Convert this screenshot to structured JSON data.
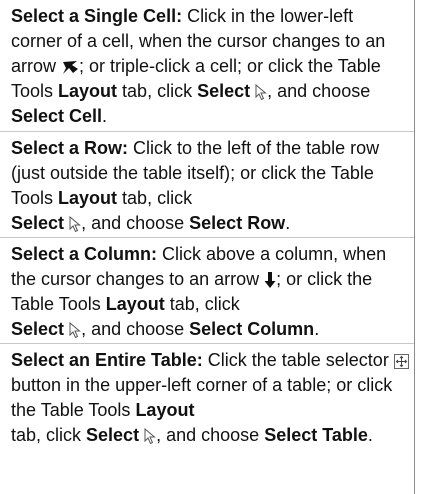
{
  "tips": [
    {
      "title": "Select a Single Cell:",
      "s1": " Click in the lower-left corner of a cell, when the cursor changes to an arrow ",
      "s2": "; or triple-click a cell; or click the Table Tools ",
      "b1": "Layout",
      "s3": " tab, click ",
      "b2": "Select",
      "s4": ", and choose ",
      "b3": "Select Cell",
      "s5": "."
    },
    {
      "title": "Select a Row:",
      "s1": " Click to the left of the table row (just outside the table itself); or click the Table Tools ",
      "b1": "Layout",
      "s2": " tab, click ",
      "b2": "Select",
      "s3": ", and choose ",
      "b3": "Select Row",
      "s4": "."
    },
    {
      "title": "Select a Column:",
      "s1": " Click above a column, when the cursor changes to an arrow ",
      "s2": "; or click the Table Tools ",
      "b1": "Layout",
      "s3": " tab, click ",
      "b2": "Select",
      "s4": ", and choose ",
      "b3": "Select Column",
      "s5": "."
    },
    {
      "title": "Select an Entire Table:",
      "s1": " Click the table selector ",
      "s2": " button in the upper-left corner of a table; or click the Table Tools ",
      "b1": "Layout",
      "s3": " tab, click ",
      "b2": "Select",
      "s4": ", and choose ",
      "b3": "Select Table",
      "s5": "."
    }
  ],
  "icons": {
    "cell_arrow": "diagonal-arrow-cursor-icon",
    "select_cursor": "pointer-cursor-icon",
    "column_arrow": "down-arrow-cursor-icon",
    "table_selector": "move-handle-icon"
  },
  "colors": {
    "text": "#111111",
    "separator": "#c8c8c8",
    "right_rule": "#8c8c8c"
  }
}
